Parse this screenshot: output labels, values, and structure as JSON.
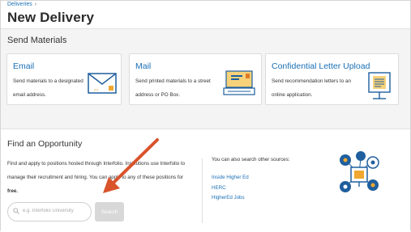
{
  "header": {
    "breadcrumb": "Deliveries",
    "breadcrumb_sep": "›",
    "title": "New Delivery"
  },
  "send_materials": {
    "title": "Send Materials",
    "cards": [
      {
        "title": "Email",
        "line1": "Send materials to a designated",
        "line2": "email address.",
        "icon": "envelope-icon"
      },
      {
        "title": "Mail",
        "line1": "Send printed materials to a street",
        "line2": "address or PO Box.",
        "icon": "mail-package-icon"
      },
      {
        "title": "Confidential Letter Upload",
        "line1": "Send recommendation letters to an",
        "line2": "online application.",
        "icon": "document-upload-icon"
      }
    ]
  },
  "opportunity": {
    "title": "Find an Opportunity",
    "desc_line1": "Find and apply to positions hosted through Interfolio. Institutions use Interfolio to",
    "desc_line2": "manage their recruitment and hiring. You can apply to any of these positions for",
    "desc_line3": "free.",
    "search": {
      "placeholder": "e.g. Interfolio University",
      "button_label": "Search"
    },
    "other_sources_label": "You can also search other sources:",
    "links": [
      "Inside Higher Ed",
      "HERC",
      "HigherEd Jobs"
    ]
  },
  "colors": {
    "accent": "#1a6fb5",
    "arrow": "#d9532b",
    "icon_blue": "#1f5f9e",
    "icon_orange": "#f0a830"
  }
}
